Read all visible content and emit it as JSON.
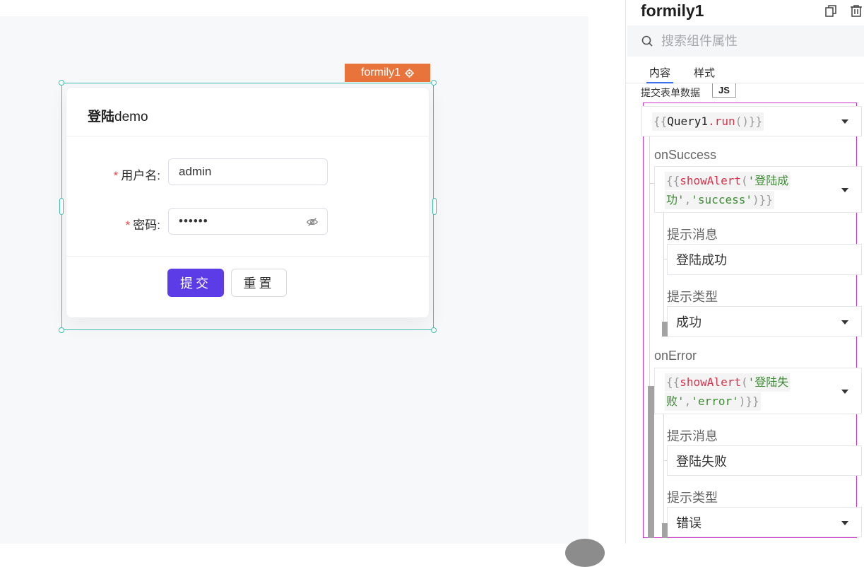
{
  "canvas": {
    "component_tag": "formily1",
    "form": {
      "title_bold": "登陆",
      "title_rest": "demo",
      "fields": [
        {
          "label": "用户名:",
          "required_mark": "*",
          "value": "admin"
        },
        {
          "label": "密码:",
          "required_mark": "*",
          "value": "••••••"
        }
      ],
      "submit_label": "提交",
      "reset_label": "重置"
    }
  },
  "panel": {
    "title": "formily1",
    "search_placeholder": "搜索组件属性",
    "tabs": [
      {
        "label": "内容",
        "active": true
      },
      {
        "label": "样式",
        "active": false
      }
    ],
    "submit_field_label": "提交表单数据",
    "js_badge": "JS",
    "query": {
      "open": "{{",
      "name": "Query1",
      "dot": ".",
      "method": "run",
      "close": "()}}"
    },
    "on_success": {
      "label": "onSuccess",
      "code": {
        "open": "{{",
        "fn": "showAlert",
        "paren": "(",
        "str1": "'登陆成",
        "str2": "功'",
        "comma": ",",
        "str3": "'success'",
        "close": ")}}"
      },
      "message_label": "提示消息",
      "message_value": "登陆成功",
      "type_label": "提示类型",
      "type_value": "成功"
    },
    "on_error": {
      "label": "onError",
      "code": {
        "open": "{{",
        "fn": "showAlert",
        "paren": "(",
        "str1": "'登陆失",
        "str2": "败'",
        "comma": ",",
        "str3": "'error'",
        "close": ")}}"
      },
      "message_label": "提示消息",
      "message_value": "登陆失败",
      "type_label": "提示类型",
      "type_value": "错误"
    }
  },
  "colors": {
    "accent": "#5b3ce6",
    "selection": "#3ec1b0",
    "tag": "#e8743b",
    "highlight_frame": "#cc33cc"
  }
}
